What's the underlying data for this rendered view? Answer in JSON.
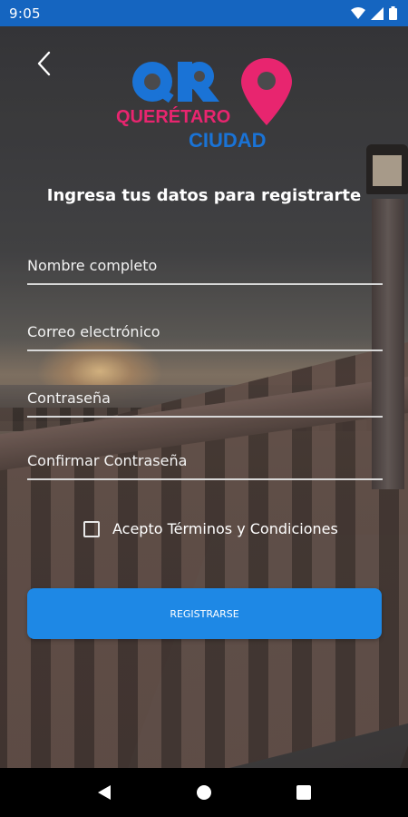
{
  "status_bar": {
    "time": "9:05",
    "icons": [
      "wifi-icon",
      "cell-signal-icon",
      "battery-icon"
    ],
    "color": "#1565c0"
  },
  "header": {
    "back_icon": "chevron-left-icon",
    "logo": {
      "top_text": "QRO",
      "middle_text": "QUERÉTARO",
      "bottom_text": "CIUDAD",
      "blue": "#1a73d6",
      "pink": "#e8256f"
    }
  },
  "form": {
    "subtitle": "Ingresa tus datos para registrarte",
    "fields": {
      "full_name": {
        "placeholder": "Nombre completo",
        "value": ""
      },
      "email": {
        "placeholder": "Correo electrónico",
        "value": ""
      },
      "password": {
        "placeholder": "Contraseña",
        "value": ""
      },
      "confirm_password": {
        "placeholder": "Confirmar Contraseña",
        "value": ""
      }
    },
    "terms_label": "Acepto Términos y Condiciones",
    "terms_checked": false,
    "submit_label": "REGISTRARSE",
    "accent": "#1e88e5"
  },
  "nav_bar": {
    "items": [
      "back-triangle-icon",
      "home-circle-icon",
      "recents-square-icon"
    ]
  }
}
